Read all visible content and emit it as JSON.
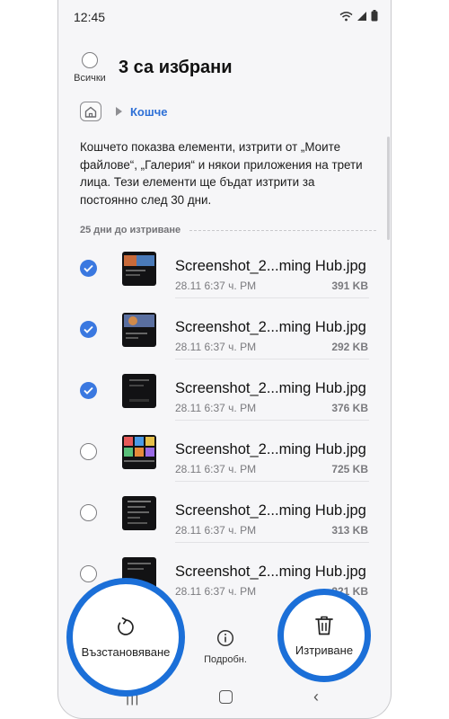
{
  "status_bar": {
    "time": "12:45"
  },
  "header": {
    "select_all_label": "Всички",
    "title": "3 са избрани"
  },
  "breadcrumb": {
    "current": "Кошче"
  },
  "description": "Кошчето показва елементи, изтрити от „Моите файлове“, „Галерия“ и някои приложения на трети лица. Тези елементи ще бъдат изтрити за постоянно след 30 дни.",
  "section": {
    "label": "25 дни до изтриване"
  },
  "files": [
    {
      "name": "Screenshot_2...ming Hub.jpg",
      "date": "28.11 6:37 ч. PM",
      "size": "391 KB",
      "selected": true
    },
    {
      "name": "Screenshot_2...ming Hub.jpg",
      "date": "28.11 6:37 ч. PM",
      "size": "292 KB",
      "selected": true
    },
    {
      "name": "Screenshot_2...ming Hub.jpg",
      "date": "28.11 6:37 ч. PM",
      "size": "376 KB",
      "selected": true
    },
    {
      "name": "Screenshot_2...ming Hub.jpg",
      "date": "28.11 6:37 ч. PM",
      "size": "725 KB",
      "selected": false
    },
    {
      "name": "Screenshot_2...ming Hub.jpg",
      "date": "28.11 6:37 ч. PM",
      "size": "313 KB",
      "selected": false
    },
    {
      "name": "Screenshot_2...ming Hub.jpg",
      "date": "28.11 6:37 ч. PM",
      "size": "321 KB",
      "selected": false
    }
  ],
  "bottom_bar": {
    "restore_label": "Възстановяване",
    "details_label": "Подробн.",
    "delete_label": "Изтриване"
  },
  "colors": {
    "accent": "#1b6fd8",
    "check": "#3a78e0",
    "link": "#2d6fd6"
  },
  "icons": [
    "wifi-icon",
    "signal-icon",
    "battery-icon",
    "home-icon",
    "restore-icon",
    "info-icon",
    "trash-icon",
    "checkmark-icon"
  ]
}
